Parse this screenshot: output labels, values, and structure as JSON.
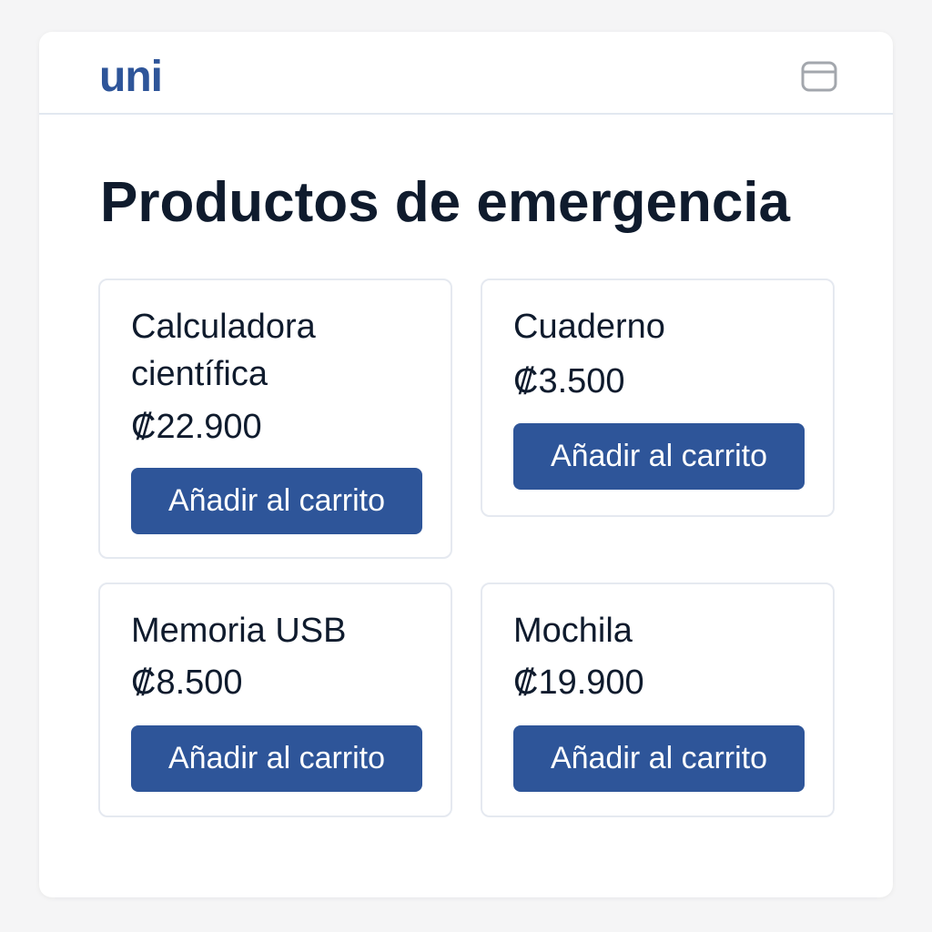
{
  "app": {
    "logo": "uni",
    "menu_icon": "browser-window-icon"
  },
  "page": {
    "title": "Productos de emergencia"
  },
  "products": [
    {
      "name": "Calculadora científica",
      "price": "₡22.900",
      "button_label": "Añadir al carrito"
    },
    {
      "name": "Cuaderno",
      "price": "₡3.500",
      "button_label": "Añadir al carrito"
    },
    {
      "name": "Memoria USB",
      "price": "₡8.500",
      "button_label": "Añadir al carrito"
    },
    {
      "name": "Mochila",
      "price": "₡19.900",
      "button_label": "Añadir al carrito"
    }
  ],
  "colors": {
    "accent": "#2e5599",
    "text": "#0f1b2d",
    "border": "#e5e9f0",
    "background": "#f5f5f6"
  }
}
